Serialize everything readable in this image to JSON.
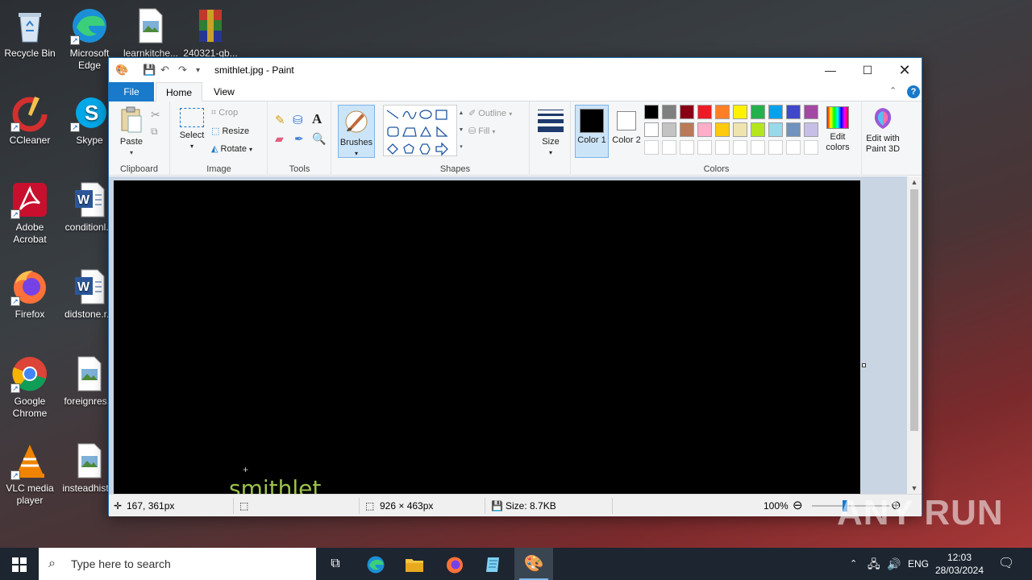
{
  "desktop": {
    "icons": [
      {
        "label": "Recycle Bin"
      },
      {
        "label": "Microsoft Edge"
      },
      {
        "label": "learnkitche..."
      },
      {
        "label": "240321-qb..."
      },
      {
        "label": "CCleaner"
      },
      {
        "label": "Skype"
      },
      {
        "label": "Adobe Acrobat"
      },
      {
        "label": "conditionl..."
      },
      {
        "label": "Firefox"
      },
      {
        "label": "didstone.r..."
      },
      {
        "label": "Google Chrome"
      },
      {
        "label": "foreignres..."
      },
      {
        "label": "VLC media player"
      },
      {
        "label": "insteadhist..."
      }
    ]
  },
  "window": {
    "title": "smithlet.jpg - Paint",
    "tabs": {
      "file": "File",
      "home": "Home",
      "view": "View"
    },
    "clipboard": {
      "paste": "Paste",
      "label": "Clipboard"
    },
    "image": {
      "select": "Select",
      "crop": "Crop",
      "resize": "Resize",
      "rotate": "Rotate",
      "label": "Image"
    },
    "tools": {
      "label": "Tools"
    },
    "brushes": {
      "label": "Brushes"
    },
    "shapes": {
      "outline": "Outline",
      "fill": "Fill",
      "label": "Shapes"
    },
    "size": {
      "label": "Size"
    },
    "colors": {
      "color1": "Color 1",
      "color2": "Color 2",
      "edit": "Edit colors",
      "label": "Colors",
      "palette_row1": [
        "#000000",
        "#7f7f7f",
        "#880015",
        "#ed1c24",
        "#ff7f27",
        "#fff200",
        "#22b14c",
        "#00a2e8",
        "#3f48cc",
        "#a349a4"
      ],
      "palette_row2": [
        "#ffffff",
        "#c3c3c3",
        "#b97a57",
        "#ffaec9",
        "#ffc90e",
        "#efe4b0",
        "#b5e61d",
        "#99d9ea",
        "#7092be",
        "#c8bfe7"
      ]
    },
    "paint3d": {
      "label": "Edit with Paint 3D"
    },
    "canvas": {
      "text": "smithlet"
    },
    "status": {
      "cursor": "167, 361px",
      "dimensions": "926 × 463px",
      "size": "Size: 8.7KB",
      "zoom": "100%"
    }
  },
  "taskbar": {
    "search_placeholder": "Type here to search",
    "language": "ENG",
    "time": "12:03",
    "date": "28/03/2024"
  },
  "watermark": "ANY RUN"
}
